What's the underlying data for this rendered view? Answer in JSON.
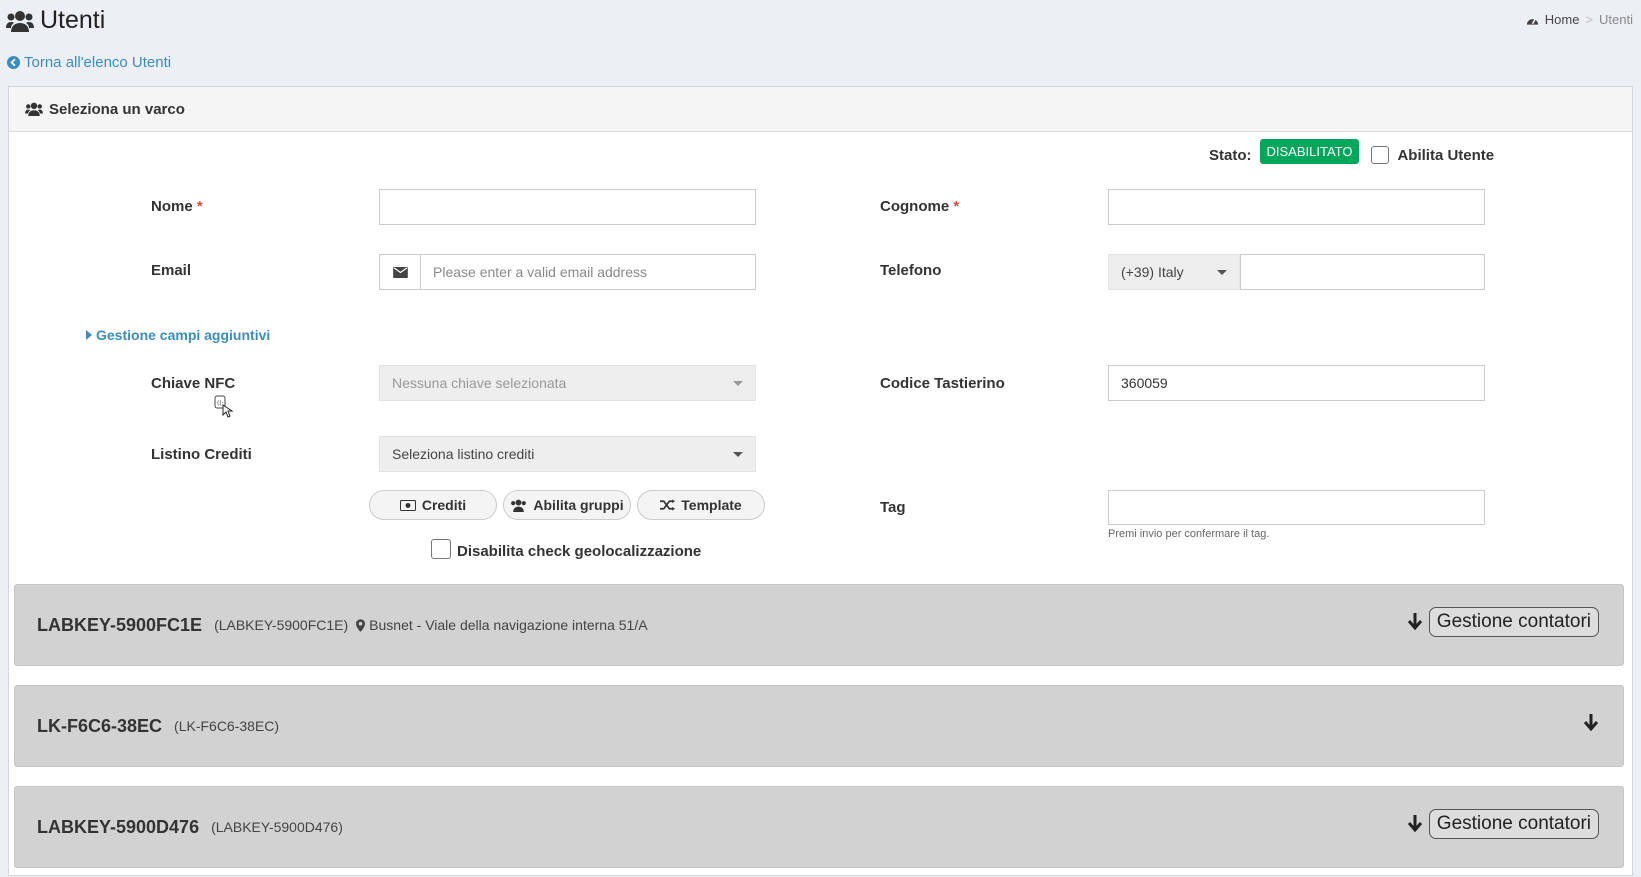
{
  "header": {
    "title": "Utenti"
  },
  "breadcrumb": {
    "home": "Home",
    "sep": ">",
    "current": "Utenti"
  },
  "back_link": "Torna all'elenco Utenti",
  "box_title": "Seleziona un varco",
  "status": {
    "label": "Stato:",
    "badge": "DISABILITATO",
    "enable_label": "Abilita Utente"
  },
  "form": {
    "nome_label": "Nome",
    "cognome_label": "Cognome",
    "required_mark": "*",
    "email_label": "Email",
    "email_placeholder": "Please enter a valid email address",
    "telefono_label": "Telefono",
    "country_code": "(+39) Italy",
    "extra_fields_link": "Gestione campi aggiuntivi",
    "nfc_label": "Chiave NFC",
    "nfc_placeholder": "Nessuna chiave selezionata",
    "keypad_label": "Codice Tastierino",
    "keypad_value": "360059",
    "credit_label": "Listino Crediti",
    "credit_select": "Seleziona listino crediti",
    "tag_label": "Tag",
    "tag_help": "Premi invio per confermare il tag.",
    "geo_label": "Disabilita check geolocalizzazione"
  },
  "buttons": {
    "crediti": "Crediti",
    "gruppi": "Abilita gruppi",
    "template": "Template"
  },
  "gates": [
    {
      "name": "LABKEY-5900FC1E",
      "code": "(LABKEY-5900FC1E)",
      "location": "Busnet - Viale della navigazione interna 51/A",
      "action": "Gestione contatori"
    },
    {
      "name": "LK-F6C6-38EC",
      "code": "(LK-F6C6-38EC)"
    },
    {
      "name": "LABKEY-5900D476",
      "code": "(LABKEY-5900D476)",
      "action": "Gestione contatori"
    }
  ],
  "colors": {
    "accent": "#3c8dbc",
    "success": "#00a65a",
    "required": "#dd4b39"
  }
}
